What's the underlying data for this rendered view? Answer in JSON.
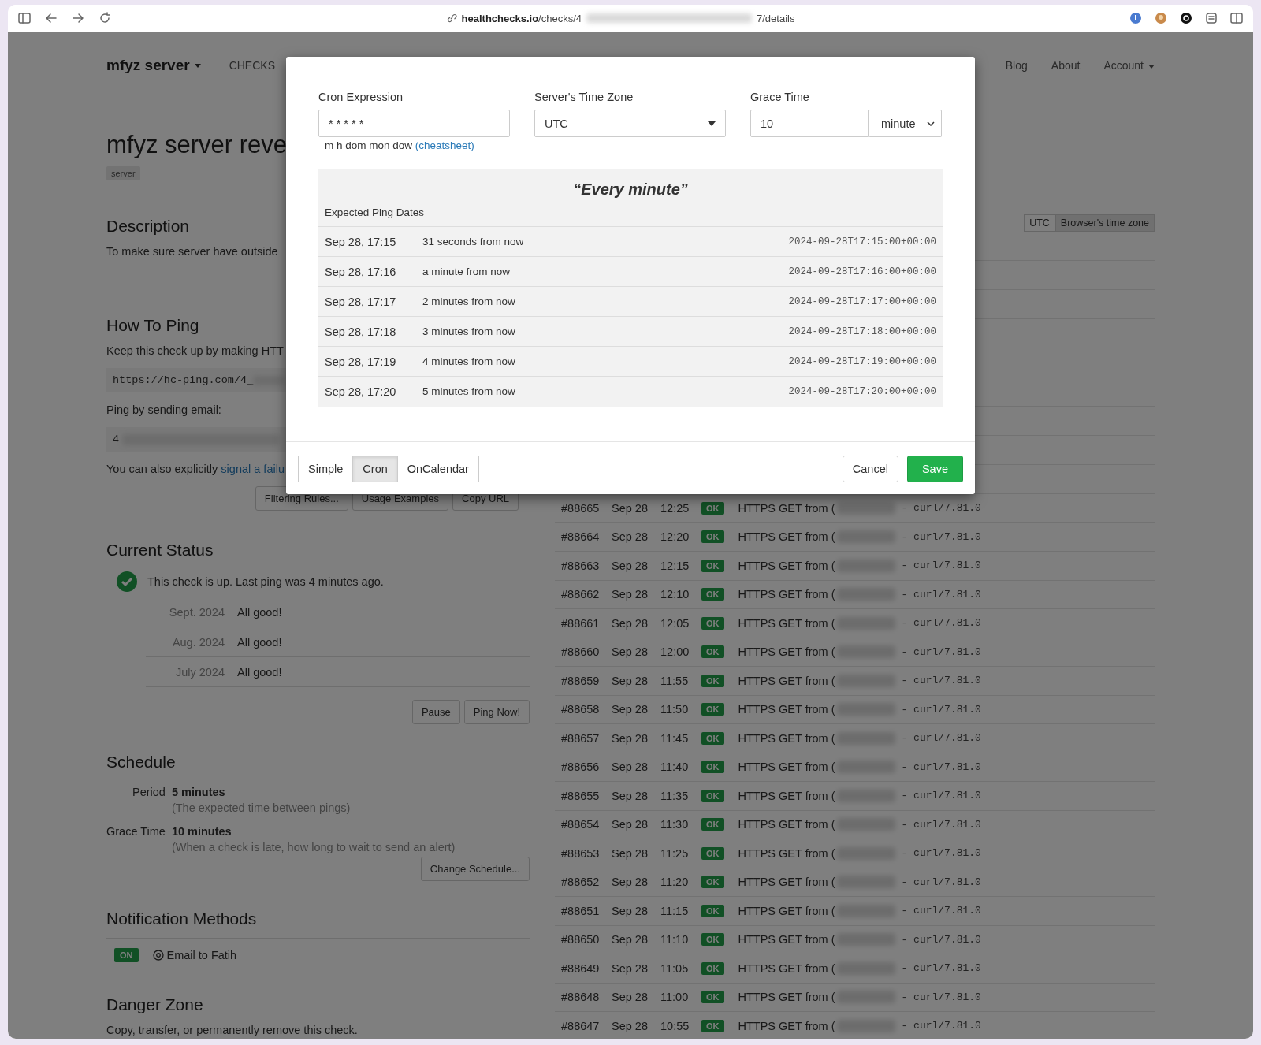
{
  "browser": {
    "url_host": "healthchecks.io",
    "url_path": "/checks/4",
    "url_tail": "7/details"
  },
  "navbar": {
    "brand": {
      "label": "mfyz server",
      "dropdown": true
    },
    "items": [
      "CHECKS"
    ],
    "right_items": [
      {
        "label": "Blog",
        "dropdown": false
      },
      {
        "label": "About",
        "dropdown": false
      },
      {
        "label": "Account",
        "dropdown": true
      }
    ]
  },
  "check": {
    "title": "mfyz server reve",
    "tags": [
      "server"
    ]
  },
  "description": {
    "heading": "Description",
    "text": "To make sure server have outside"
  },
  "how_to_ping": {
    "heading": "How To Ping",
    "intro": "Keep this check up by making HTT",
    "ping_url": "https://hc-ping.com/4_",
    "email_label": "Ping by sending email:",
    "email": "4",
    "signal_text": "You can also explicitly ",
    "signal_link": "signal a failu",
    "buttons": [
      "Filtering Rules...",
      "Usage Examples",
      "Copy URL"
    ]
  },
  "current_status": {
    "heading": "Current Status",
    "up": true,
    "message": "This check is up. Last ping was 4 minutes ago.",
    "months": [
      {
        "month": "Sept. 2024",
        "summary": "All good!"
      },
      {
        "month": "Aug. 2024",
        "summary": "All good!"
      },
      {
        "month": "July 2024",
        "summary": "All good!"
      }
    ],
    "buttons": [
      "Pause",
      "Ping Now!"
    ]
  },
  "schedule": {
    "heading": "Schedule",
    "items": [
      {
        "label": "Period",
        "value": "5 minutes",
        "note": "(The expected time between pings)"
      },
      {
        "label": "Grace Time",
        "value": "10 minutes",
        "note": "(When a check is late, how long to wait to send an alert)"
      }
    ],
    "button": "Change Schedule..."
  },
  "notifications": {
    "heading": "Notification Methods",
    "items": [
      {
        "badge": "ON",
        "on": true,
        "name": "Email to Fatih"
      }
    ]
  },
  "danger_zone": {
    "heading": "Danger Zone",
    "text": "Copy, transfer, or permanently remove this check."
  },
  "timezone_toggle": [
    {
      "label": "UTC",
      "selected": false
    },
    {
      "label": "Browser's time zone",
      "selected": true
    }
  ],
  "log": [
    {
      "number": "#88665",
      "date": "Sep 28",
      "time": "12:25",
      "status": "OK",
      "text": "HTTPS GET from (",
      "agent": "- curl/7.81.0"
    },
    {
      "number": "#88664",
      "date": "Sep 28",
      "time": "12:20",
      "status": "OK",
      "text": "HTTPS GET from (",
      "agent": "- curl/7.81.0"
    },
    {
      "number": "#88663",
      "date": "Sep 28",
      "time": "12:15",
      "status": "OK",
      "text": "HTTPS GET from (",
      "agent": "- curl/7.81.0"
    },
    {
      "number": "#88662",
      "date": "Sep 28",
      "time": "12:10",
      "status": "OK",
      "text": "HTTPS GET from (",
      "agent": "- curl/7.81.0"
    },
    {
      "number": "#88661",
      "date": "Sep 28",
      "time": "12:05",
      "status": "OK",
      "text": "HTTPS GET from (",
      "agent": "- curl/7.81.0"
    },
    {
      "number": "#88660",
      "date": "Sep 28",
      "time": "12:00",
      "status": "OK",
      "text": "HTTPS GET from (",
      "agent": "- curl/7.81.0"
    },
    {
      "number": "#88659",
      "date": "Sep 28",
      "time": "11:55",
      "status": "OK",
      "text": "HTTPS GET from (",
      "agent": "- curl/7.81.0"
    },
    {
      "number": "#88658",
      "date": "Sep 28",
      "time": "11:50",
      "status": "OK",
      "text": "HTTPS GET from (",
      "agent": "- curl/7.81.0"
    },
    {
      "number": "#88657",
      "date": "Sep 28",
      "time": "11:45",
      "status": "OK",
      "text": "HTTPS GET from (",
      "agent": "- curl/7.81.0"
    },
    {
      "number": "#88656",
      "date": "Sep 28",
      "time": "11:40",
      "status": "OK",
      "text": "HTTPS GET from (",
      "agent": "- curl/7.81.0"
    },
    {
      "number": "#88655",
      "date": "Sep 28",
      "time": "11:35",
      "status": "OK",
      "text": "HTTPS GET from (",
      "agent": "- curl/7.81.0"
    },
    {
      "number": "#88654",
      "date": "Sep 28",
      "time": "11:30",
      "status": "OK",
      "text": "HTTPS GET from (",
      "agent": "- curl/7.81.0"
    },
    {
      "number": "#88653",
      "date": "Sep 28",
      "time": "11:25",
      "status": "OK",
      "text": "HTTPS GET from (",
      "agent": "- curl/7.81.0"
    },
    {
      "number": "#88652",
      "date": "Sep 28",
      "time": "11:20",
      "status": "OK",
      "text": "HTTPS GET from (",
      "agent": "- curl/7.81.0"
    },
    {
      "number": "#88651",
      "date": "Sep 28",
      "time": "11:15",
      "status": "OK",
      "text": "HTTPS GET from (",
      "agent": "- curl/7.81.0"
    },
    {
      "number": "#88650",
      "date": "Sep 28",
      "time": "11:10",
      "status": "OK",
      "text": "HTTPS GET from (",
      "agent": "- curl/7.81.0"
    },
    {
      "number": "#88649",
      "date": "Sep 28",
      "time": "11:05",
      "status": "OK",
      "text": "HTTPS GET from (",
      "agent": "- curl/7.81.0"
    },
    {
      "number": "#88648",
      "date": "Sep 28",
      "time": "11:00",
      "status": "OK",
      "text": "HTTPS GET from (",
      "agent": "- curl/7.81.0"
    },
    {
      "number": "#88647",
      "date": "Sep 28",
      "time": "10:55",
      "status": "OK",
      "text": "HTTPS GET from (",
      "agent": "- curl/7.81.0"
    }
  ],
  "schedule_dialog": {
    "cron": {
      "label": "Cron Expression",
      "value": "* * * * *",
      "hint": "m h dom mon dow ",
      "hint_link": "(cheatsheet)"
    },
    "timezone": {
      "label": "Server's Time Zone",
      "value": "UTC"
    },
    "grace": {
      "label": "Grace Time",
      "value": "10",
      "unit": "minute"
    },
    "summary": "“Every minute”",
    "expected_heading": "Expected Ping Dates",
    "expected": [
      {
        "date": "Sep 28, 17:15",
        "relative": "31 seconds from now",
        "iso": "2024-09-28T17:15:00+00:00"
      },
      {
        "date": "Sep 28, 17:16",
        "relative": "a minute from now",
        "iso": "2024-09-28T17:16:00+00:00"
      },
      {
        "date": "Sep 28, 17:17",
        "relative": "2 minutes from now",
        "iso": "2024-09-28T17:17:00+00:00"
      },
      {
        "date": "Sep 28, 17:18",
        "relative": "3 minutes from now",
        "iso": "2024-09-28T17:18:00+00:00"
      },
      {
        "date": "Sep 28, 17:19",
        "relative": "4 minutes from now",
        "iso": "2024-09-28T17:19:00+00:00"
      },
      {
        "date": "Sep 28, 17:20",
        "relative": "5 minutes from now",
        "iso": "2024-09-28T17:20:00+00:00"
      }
    ],
    "modes": [
      {
        "label": "Simple",
        "selected": false
      },
      {
        "label": "Cron",
        "selected": true
      },
      {
        "label": "OnCalendar",
        "selected": false
      }
    ],
    "cancel": "Cancel",
    "save": "Save"
  }
}
